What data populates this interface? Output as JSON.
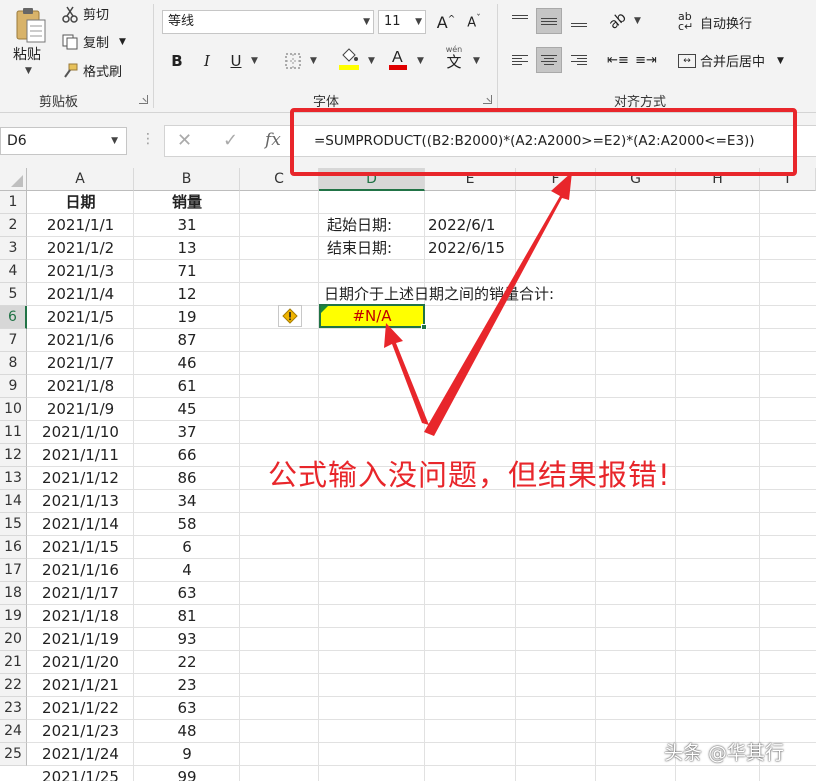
{
  "ribbon": {
    "clipboard": {
      "paste": "粘贴",
      "cut": "剪切",
      "copy": "复制",
      "format_painter": "格式刷",
      "group_label": "剪贴板"
    },
    "font": {
      "font_name": "等线",
      "font_size": "11",
      "bold": "B",
      "italic": "I",
      "underline": "U",
      "font_color": "#e00000",
      "fill_color": "#ffff00",
      "phonetic_label": "wén",
      "phonetic_char": "文",
      "group_label": "字体"
    },
    "alignment": {
      "wrap_text": "自动换行",
      "merge_center": "合并后居中",
      "group_label": "对齐方式"
    }
  },
  "formula_bar": {
    "name_box": "D6",
    "formula": "=SUMPRODUCT((B2:B2000)*(A2:A2000>=E2)*(A2:A2000<=E3))",
    "fx": "fx"
  },
  "sheet": {
    "columns": [
      "A",
      "B",
      "C",
      "D",
      "E",
      "F",
      "G",
      "H",
      "I"
    ],
    "rows": [
      "1",
      "2",
      "3",
      "4",
      "5",
      "6",
      "7",
      "8",
      "9",
      "10",
      "11",
      "12",
      "13",
      "14",
      "15",
      "16",
      "17",
      "18",
      "19",
      "20",
      "21",
      "22",
      "23",
      "24",
      "25"
    ],
    "header": {
      "date": "日期",
      "sales": "销量"
    },
    "data": [
      [
        "2021/1/1",
        "31"
      ],
      [
        "2021/1/2",
        "13"
      ],
      [
        "2021/1/3",
        "71"
      ],
      [
        "2021/1/4",
        "12"
      ],
      [
        "2021/1/5",
        "19"
      ],
      [
        "2021/1/6",
        "87"
      ],
      [
        "2021/1/7",
        "46"
      ],
      [
        "2021/1/8",
        "61"
      ],
      [
        "2021/1/9",
        "45"
      ],
      [
        "2021/1/10",
        "37"
      ],
      [
        "2021/1/11",
        "66"
      ],
      [
        "2021/1/12",
        "86"
      ],
      [
        "2021/1/13",
        "34"
      ],
      [
        "2021/1/14",
        "58"
      ],
      [
        "2021/1/15",
        "6"
      ],
      [
        "2021/1/16",
        "4"
      ],
      [
        "2021/1/17",
        "63"
      ],
      [
        "2021/1/18",
        "81"
      ],
      [
        "2021/1/19",
        "93"
      ],
      [
        "2021/1/20",
        "22"
      ],
      [
        "2021/1/21",
        "23"
      ],
      [
        "2021/1/22",
        "63"
      ],
      [
        "2021/1/23",
        "48"
      ],
      [
        "2021/1/24",
        "9"
      ],
      [
        "2021/1/25",
        "99"
      ]
    ],
    "start_label": "起始日期:",
    "start_value": "2022/6/1",
    "end_label": "结束日期:",
    "end_value": "2022/6/15",
    "sum_label": "日期介于上述日期之间的销量合计:",
    "result": "#N/A",
    "selected_column": "D",
    "selected_row": "6"
  },
  "annotation": {
    "text": "公式输入没问题，但结果报错!",
    "color": "#e8262b"
  },
  "watermark": "头条 @华其行"
}
